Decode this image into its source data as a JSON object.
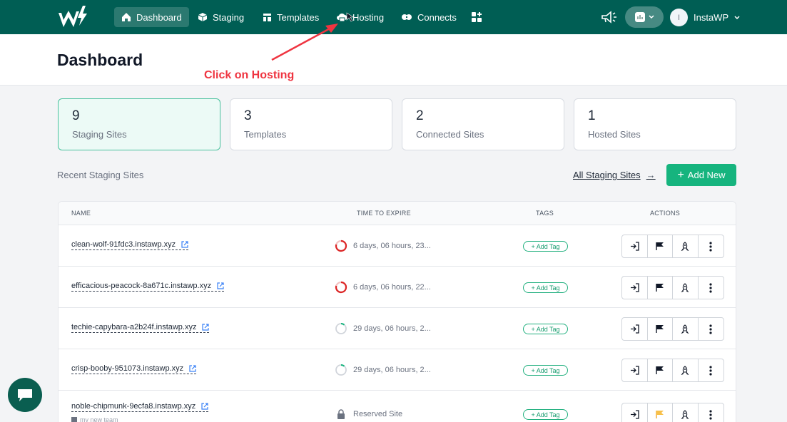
{
  "nav": {
    "items": [
      {
        "label": "Dashboard",
        "icon": "home-icon",
        "active": true
      },
      {
        "label": "Staging",
        "icon": "cube-icon"
      },
      {
        "label": "Templates",
        "icon": "template-icon"
      },
      {
        "label": "Hosting",
        "icon": "cloud-icon"
      },
      {
        "label": "Connects",
        "icon": "link-icon"
      }
    ],
    "user": {
      "initial": "I",
      "name": "InstaWP"
    }
  },
  "page": {
    "title": "Dashboard"
  },
  "annotation": {
    "text": "Click on Hosting",
    "color": "#ef3440"
  },
  "stats": [
    {
      "value": "9",
      "label": "Staging Sites"
    },
    {
      "value": "3",
      "label": "Templates"
    },
    {
      "value": "2",
      "label": "Connected Sites"
    },
    {
      "value": "1",
      "label": "Hosted Sites"
    }
  ],
  "section": {
    "title": "Recent Staging Sites",
    "all_link": "All Staging Sites",
    "add_new": "Add New"
  },
  "table": {
    "headers": [
      "NAME",
      "TIME TO EXPIRE",
      "TAGS",
      "ACTIONS"
    ],
    "tag_label": "+ Add Tag",
    "rows": [
      {
        "name": "clean-wolf-91fdc3.instawp.xyz",
        "expire": "6 days, 06 hours, 23..."
      },
      {
        "name": "efficacious-peacock-8a671c.instawp.xyz",
        "expire": "6 days, 06 hours, 22..."
      },
      {
        "name": "techie-capybara-a2b24f.instawp.xyz",
        "expire": "29 days, 06 hours, 2..."
      },
      {
        "name": "crisp-booby-951073.instawp.xyz",
        "expire": "29 days, 06 hours, 2..."
      },
      {
        "name": "noble-chipmunk-9ecfa8.instawp.xyz",
        "expire": "Reserved Site",
        "subtag": "my new team"
      }
    ]
  },
  "colors": {
    "brand": "#005e54",
    "accent": "#16b47e",
    "danger": "#ef3440"
  }
}
